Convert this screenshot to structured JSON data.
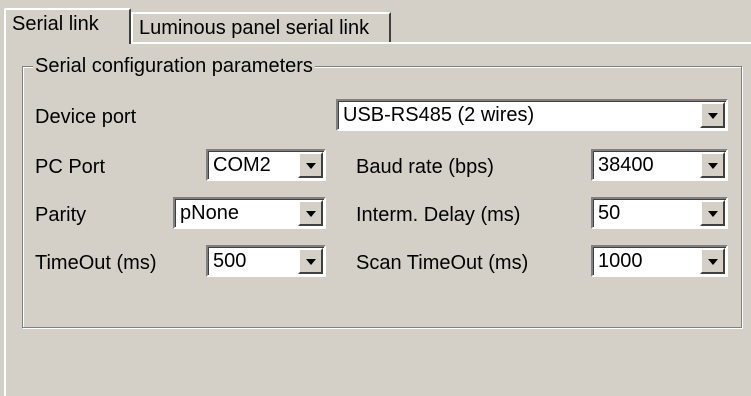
{
  "tabs": [
    {
      "label": "Serial link",
      "active": true
    },
    {
      "label": "Luminous panel serial link",
      "active": false
    }
  ],
  "group": {
    "title": "Serial configuration parameters"
  },
  "fields": {
    "device_port": {
      "label": "Device port",
      "value": "USB-RS485 (2 wires)"
    },
    "pc_port": {
      "label": "PC Port",
      "value": "COM2"
    },
    "baud_rate": {
      "label": "Baud rate (bps)",
      "value": "38400"
    },
    "parity": {
      "label": "Parity",
      "value": "pNone"
    },
    "interm_delay": {
      "label": "Interm. Delay (ms)",
      "value": "50"
    },
    "timeout": {
      "label": "TimeOut (ms)",
      "value": "500"
    },
    "scan_timeout": {
      "label": "Scan TimeOut (ms)",
      "value": "1000"
    }
  },
  "icons": {
    "dropdown": "chevron-down-icon"
  },
  "colors": {
    "face": "#d4d0c8",
    "field": "#ffffff",
    "shadow": "#808080",
    "dark_shadow": "#404040",
    "highlight": "#ffffff"
  }
}
